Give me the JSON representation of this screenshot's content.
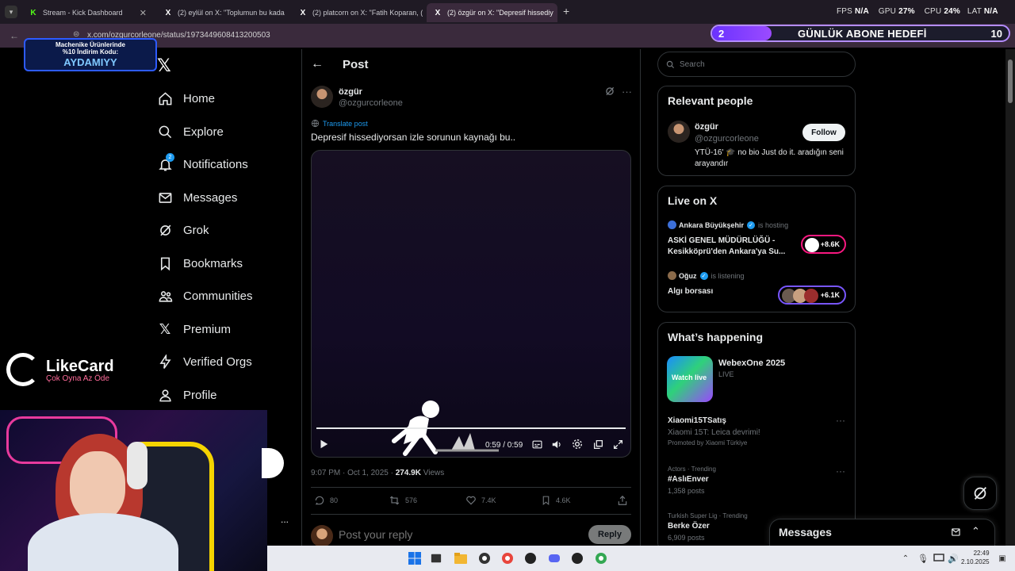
{
  "browser": {
    "tabs": [
      {
        "label": "Stream - Kick Dashboard",
        "favicon": "K",
        "active": false
      },
      {
        "label": "(2) eylül on X: \"Toplumun bu kada",
        "favicon": "X",
        "active": false
      },
      {
        "label": "(2) platcorn on X: \"Fatih Koparan, (",
        "favicon": "X",
        "active": false
      },
      {
        "label": "(2) özgür on X: \"Depresif hissediy",
        "favicon": "X",
        "active": true
      }
    ],
    "url": "x.com/ozgurcorleone/status/1973449608413200503",
    "new_tab_symbol": "+"
  },
  "overlay": {
    "stats": {
      "fps_label": "FPS",
      "fps_value": "N/A",
      "gpu_label": "GPU",
      "gpu_value": "27%",
      "cpu_label": "CPU",
      "cpu_value": "24%",
      "lat_label": "LAT",
      "lat_value": "N/A"
    },
    "subscriber_goal": {
      "current": "2",
      "label": "GÜNLÜK ABONE HEDEFİ",
      "target": "10",
      "progress_fraction": 0.2
    },
    "promo": {
      "line1": "Machenike Ürünlerinde",
      "line2": "%10 İndirim Kodu:",
      "code": "AYDAMIYY"
    },
    "likecard": {
      "name": "LikeCard",
      "tagline": "Çok Oyna  Az Öde"
    }
  },
  "nav": {
    "items": [
      {
        "label": "Home",
        "icon": "home-icon"
      },
      {
        "label": "Explore",
        "icon": "search-icon"
      },
      {
        "label": "Notifications",
        "icon": "bell-icon",
        "badge": "2"
      },
      {
        "label": "Messages",
        "icon": "envelope-icon"
      },
      {
        "label": "Grok",
        "icon": "grok-icon"
      },
      {
        "label": "Bookmarks",
        "icon": "bookmark-icon"
      },
      {
        "label": "Communities",
        "icon": "people-icon"
      },
      {
        "label": "Premium",
        "icon": "x-logo-icon"
      },
      {
        "label": "Verified Orgs",
        "icon": "lightning-icon"
      },
      {
        "label": "Profile",
        "icon": "person-icon"
      }
    ],
    "more_symbol": "..."
  },
  "post": {
    "header_title": "Post",
    "author_name": "özgür",
    "author_handle": "@ozgurcorleone",
    "translate_label": "Translate post",
    "text": "Depresif hissediyorsan izle sorunun kaynağı bu..",
    "video_time": "0:59 / 0:59",
    "timestamp": "9:07 PM · Oct 1, 2025 · ",
    "views_count": "274.9K",
    "views_label": " Views",
    "actions": {
      "replies": "80",
      "reposts": "576",
      "likes": "7.4K",
      "bookmarks": "4.6K"
    },
    "reply_placeholder": "Post your reply",
    "reply_button": "Reply"
  },
  "sidebar": {
    "search_placeholder": "Search",
    "relevant_people": {
      "title": "Relevant people",
      "name": "özgür",
      "handle": "@ozgurcorleone",
      "follow_label": "Follow",
      "bio": "YTÜ-16' 🎓 no bio Just do it. aradığın seni arayandır"
    },
    "live": {
      "title": "Live on X",
      "items": [
        {
          "host": "Ankara Büyükşehir",
          "status": "is hosting",
          "title": "ASKİ GENEL MÜDÜRLÜĞÜ - Kesikköprü'den Ankara'ya Su...",
          "listeners": "+8.6K"
        },
        {
          "host": "Oğuz",
          "status": "is listening",
          "title": "Algı borsası",
          "listeners": "+6.1K"
        }
      ]
    },
    "happening": {
      "title": "What’s happening",
      "featured": {
        "title": "WebexOne 2025",
        "status": "LIVE",
        "image_text": "Watch live"
      },
      "trends": [
        {
          "category": "",
          "title": "Xiaomi15TSatış",
          "sub": "Xiaomi 15T: Leica devrimi!",
          "extra": "Promoted by Xiaomi Türkiye"
        },
        {
          "category": "Actors · Trending",
          "title": "#AslıEnver",
          "sub": "1,358 posts",
          "extra": ""
        },
        {
          "category": "Turkish Super Lig · Trending",
          "title": "Berke Özer",
          "sub": "6,909 posts",
          "extra": ""
        }
      ]
    }
  },
  "messages_drawer": {
    "title": "Messages"
  },
  "taskbar": {
    "time": "22:49",
    "date": "2.10.2025"
  }
}
